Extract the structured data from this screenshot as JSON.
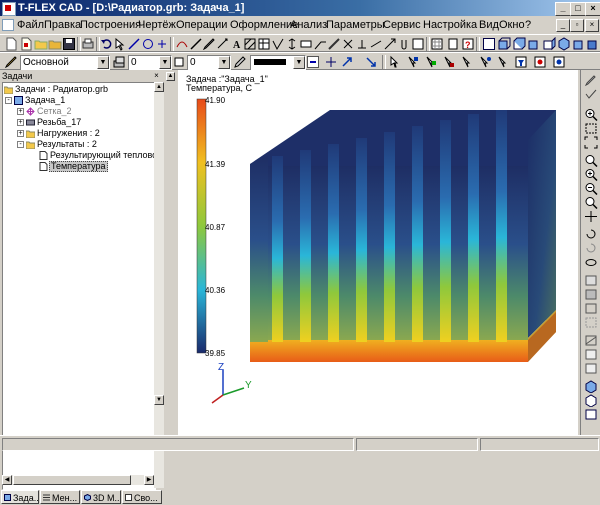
{
  "window": {
    "title": "T-FLEX CAD - [D:\\Радиатор.grb: Задача_1]"
  },
  "menubar": {
    "items": [
      "Файл",
      "Правка",
      "Построения",
      "Чертёж",
      "Операции",
      "Оформление",
      "Анализ",
      "Параметры",
      "Сервис",
      "Настройка",
      "Вид",
      "Окно",
      "?"
    ]
  },
  "toolbar2": {
    "layer_value": "Основной",
    "field1_value": "0",
    "field2_value": "0"
  },
  "left_panel": {
    "title": "Задачи",
    "tree": [
      {
        "label": "Задачи : Радиатор.grb",
        "level": 0,
        "icon": "folder-icon"
      },
      {
        "label": "Задача_1",
        "level": 1,
        "icon": "task-icon",
        "expander": "-"
      },
      {
        "label": "Сетка_2",
        "level": 2,
        "icon": "mesh-icon",
        "expander": "+"
      },
      {
        "label": "Резьба_17",
        "level": 2,
        "icon": "body-icon",
        "expander": "+"
      },
      {
        "label": "Нагружения : 2",
        "level": 2,
        "icon": "loads-icon",
        "expander": "+"
      },
      {
        "label": "Результаты : 2",
        "level": 2,
        "icon": "results-icon",
        "expander": "-"
      },
      {
        "label": "Результирующий тепловой",
        "level": 3,
        "icon": "result-doc-icon"
      },
      {
        "label": "Температура",
        "level": 3,
        "icon": "result-doc-icon",
        "selected": true
      }
    ],
    "tabs": [
      "Зада...",
      "Мен...",
      "3D М...",
      "Сво..."
    ]
  },
  "viewport": {
    "header_line1": "Задача :\"Задача_1\"",
    "header_line2": "Температура, С",
    "legend_values": [
      "41.90",
      "41.39",
      "40.87",
      "40.36",
      "39.85"
    ],
    "axis_labels": {
      "z": "Z",
      "y": "Y"
    },
    "colors": {
      "max": "#e84a1a",
      "mid": "#8ec83c",
      "min": "#1a2a6c"
    }
  }
}
